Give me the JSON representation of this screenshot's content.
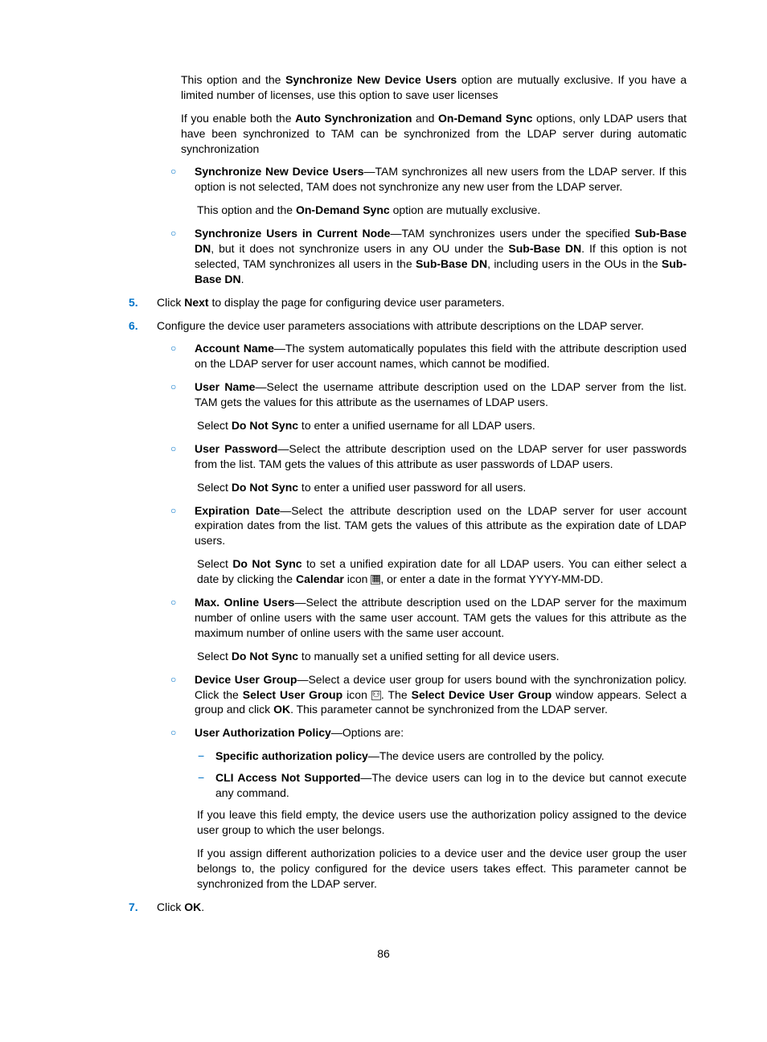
{
  "p1": {
    "a": "This option and the ",
    "b": "Synchronize New Device Users",
    "c": " option are mutually exclusive. If you have a limited number of licenses, use this option to save user licenses"
  },
  "p2": {
    "a": "If you enable both the ",
    "b": "Auto Synchronization",
    "c": " and ",
    "d": "On-Demand Sync",
    "e": " options, only LDAP users that have been synchronized to TAM can be synchronized from the LDAP server during automatic synchronization"
  },
  "b1": {
    "t": "Synchronize New Device Users",
    "d": "—TAM synchronizes all new users from the LDAP server. If this option is not selected, TAM does not synchronize any new user from the LDAP server."
  },
  "b1p": {
    "a": "This option and the ",
    "b": "On-Demand Sync",
    "c": " option are mutually exclusive."
  },
  "b2": {
    "t": "Synchronize Users in Current Node",
    "d1": "—TAM synchronizes users under the specified ",
    "d2": "Sub-Base DN",
    "d3": ", but it does not synchronize users in any OU under the ",
    "d4": "Sub-Base DN",
    "d5": ". If this option is not selected, TAM synchronizes all users in the ",
    "d6": "Sub-Base DN",
    "d7": ", including users in the OUs in the ",
    "d8": "Sub-Base DN",
    "d9": "."
  },
  "step5": {
    "n": "5.",
    "a": "Click ",
    "b": "Next",
    "c": " to display the page for configuring device user parameters."
  },
  "step6": {
    "n": "6.",
    "a": "Configure the device user parameters associations with attribute descriptions on the LDAP server."
  },
  "s6b1": {
    "t": "Account Name",
    "d": "—The system automatically populates this field with the attribute description used on the LDAP server for user account names, which cannot be modified."
  },
  "s6b2": {
    "t": "User Name",
    "d": "—Select the username attribute description used on the LDAP server from the list. TAM gets the values for this attribute as the usernames of LDAP users."
  },
  "s6b2p": {
    "a": "Select ",
    "b": "Do Not Sync",
    "c": " to enter a unified username for all LDAP users."
  },
  "s6b3": {
    "t": "User Password",
    "d": "—Select the attribute description used on the LDAP server for user passwords from the list. TAM gets the values of this attribute as user passwords of LDAP users."
  },
  "s6b3p": {
    "a": "Select ",
    "b": "Do Not Sync",
    "c": " to enter a unified user password for all users."
  },
  "s6b4": {
    "t": "Expiration Date",
    "d": "—Select the attribute description used on the LDAP server for user account expiration dates from the list. TAM gets the values of this attribute as the expiration date of LDAP users."
  },
  "s6b4p": {
    "a": "Select ",
    "b": "Do Not Sync",
    "c": " to set a unified expiration date for all LDAP users. You can either select a date by clicking the ",
    "d": "Calendar",
    "e": " icon ",
    "f": ", or enter a date in the format YYYY-MM-DD."
  },
  "s6b5": {
    "t": "Max. Online Users",
    "d": "—Select the attribute description used on the LDAP server for the maximum number of online users with the same user account. TAM gets the values for this attribute as the maximum number of online users with the same user account."
  },
  "s6b5p": {
    "a": "Select ",
    "b": "Do Not Sync",
    "c": " to manually set a unified setting for all device users."
  },
  "s6b6": {
    "t": "Device User Group",
    "d1": "—Select a device user group for users bound with the synchronization policy. Click the ",
    "d2": "Select User Group",
    "d3": " icon ",
    "d4": ". The ",
    "d5": "Select Device User Group",
    "d6": " window appears. Select a group and click ",
    "d7": "OK",
    "d8": ". This parameter cannot be synchronized from the LDAP server."
  },
  "s6b7": {
    "t": "User Authorization Policy",
    "d": "—Options are:"
  },
  "d1": {
    "t": "Specific authorization policy",
    "d": "—The device users are controlled by the policy."
  },
  "d2": {
    "t": "CLI Access Not Supported",
    "d": "—The device users can log in to the device but cannot execute any command."
  },
  "s6b7p1": "If you leave this field empty, the device users use the authorization policy assigned to the device user group to which the user belongs.",
  "s6b7p2": "If you assign different authorization policies to a device user and the device user group the user belongs to, the policy configured for the device users takes effect. This parameter cannot be synchronized from the LDAP server.",
  "step7": {
    "n": "7.",
    "a": "Click ",
    "b": "OK",
    "c": "."
  },
  "pagenum": "86"
}
